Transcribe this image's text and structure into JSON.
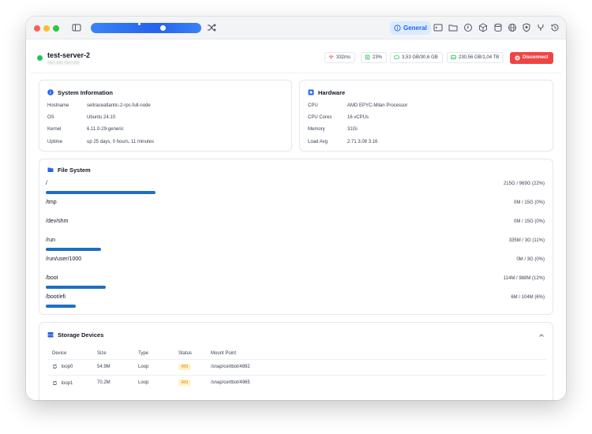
{
  "titlebar": {
    "tabs": [
      {
        "label": "General",
        "icon": "info-circle-icon"
      }
    ],
    "icons": [
      "sidebar-toggle-icon",
      "shuffle-icon",
      "terminal-icon",
      "folder-icon",
      "clock-icon",
      "box-icon",
      "database-icon",
      "globe-icon",
      "shield-icon",
      "fork-icon",
      "history-icon"
    ]
  },
  "server": {
    "name": "test-server-2",
    "subtitle": "xxx.xxx.xxx.xxx",
    "status_color": "#22c55e"
  },
  "metrics": {
    "latency": "332ms",
    "cpu": "23%",
    "memory": "3,53 GB/30,6 GB",
    "disk": "230,56 GB/1,04 TB"
  },
  "actions": {
    "disconnect_label": "Disconnect"
  },
  "system_info": {
    "title": "System Information",
    "rows": [
      {
        "key": "Hostname",
        "value": "seitraceatlantic-2-rpc-full-node"
      },
      {
        "key": "OS",
        "value": "Ubuntu 24.10"
      },
      {
        "key": "Kernel",
        "value": "6.11.0-29-generic"
      },
      {
        "key": "Uptime",
        "value": "up 25 days, 0 hours, 11 minutes"
      }
    ]
  },
  "hardware": {
    "title": "Hardware",
    "rows": [
      {
        "key": "CPU",
        "value": "AMD EPYC-Milan Processor"
      },
      {
        "key": "CPU Cores",
        "value": "16 vCPUs"
      },
      {
        "key": "Memory",
        "value": "31Gi"
      },
      {
        "key": "Load Avg",
        "value": "2.71 3.08 3.16"
      }
    ]
  },
  "file_system": {
    "title": "File System",
    "entries": [
      {
        "path": "/",
        "usage": "215G / 969G (22%)",
        "percent": 22
      },
      {
        "path": "/tmp",
        "usage": "0M / 15G (0%)",
        "percent": 0
      },
      {
        "path": "/dev/shm",
        "usage": "0M / 15G (0%)",
        "percent": 0
      },
      {
        "path": "/run",
        "usage": "335M / 3G (11%)",
        "percent": 11
      },
      {
        "path": "/run/user/1000",
        "usage": "0M / 3G (0%)",
        "percent": 0
      },
      {
        "path": "/boot",
        "usage": "114M / 988M (12%)",
        "percent": 12
      },
      {
        "path": "/boot/efi",
        "usage": "6M / 104M (6%)",
        "percent": 6
      }
    ]
  },
  "storage": {
    "title": "Storage Devices",
    "columns": [
      "Device",
      "Size",
      "Type",
      "Status",
      "Mount Point"
    ],
    "rows": [
      {
        "device": "loop0",
        "size": "54.9M",
        "type": "Loop",
        "status": "RO",
        "mount": "/snap/certbot/4892"
      },
      {
        "device": "loop1",
        "size": "70.2M",
        "type": "Loop",
        "status": "RO",
        "mount": "/snap/certbot/4965"
      }
    ]
  },
  "colors": {
    "accent": "#2563eb",
    "danger": "#ef4444",
    "bar": "#1e6fc4",
    "success": "#22c55e"
  }
}
